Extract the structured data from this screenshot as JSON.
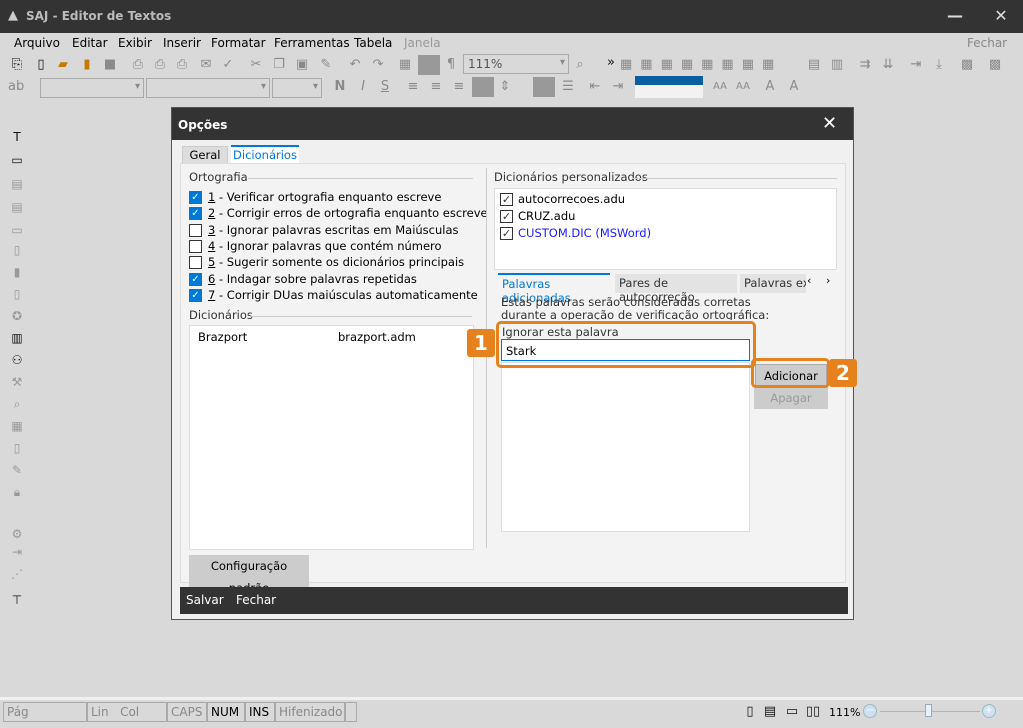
{
  "window": {
    "title": "SAJ - Editor de Textos",
    "close_doc": "Fechar"
  },
  "menu": [
    "Arquivo",
    "Editar",
    "Exibir",
    "Inserir",
    "Formatar",
    "Ferramentas",
    "Tabela",
    "Janela"
  ],
  "toolbar": {
    "zoom": "111%"
  },
  "dialog": {
    "title": "Opções",
    "tabs": [
      {
        "label": "Geral",
        "active": false
      },
      {
        "label": "Dicionários",
        "active": true
      }
    ],
    "ortografia": {
      "label": "Ortografia",
      "options": [
        {
          "num": "1",
          "text": " - Verificar ortografia enquanto escreve",
          "checked": true
        },
        {
          "num": "2",
          "text": " - Corrigir erros de ortografia enquanto escreve",
          "checked": true
        },
        {
          "num": "3",
          "text": " - Ignorar palavras escritas em Maiúsculas",
          "checked": false
        },
        {
          "num": "4",
          "text": " - Ignorar palavras que contém número",
          "checked": false
        },
        {
          "num": "5",
          "text": " - Sugerir somente os dicionários principais",
          "checked": false
        },
        {
          "num": "6",
          "text": " - Indagar sobre palavras repetidas",
          "checked": true
        },
        {
          "num": "7",
          "text": " - Corrigir DUas maiúsculas automaticamente",
          "checked": true
        }
      ]
    },
    "dicionarios": {
      "label": "Dicionários",
      "rows": [
        {
          "name": "Brazport",
          "file": "brazport.adm"
        }
      ]
    },
    "default_button": "Configuração padrão",
    "personalizados": {
      "label": "Dicionários personalizados",
      "items": [
        {
          "name": "autocorrecoes.adu",
          "checked": true
        },
        {
          "name": "CRUZ.adu",
          "checked": true
        },
        {
          "name": "CUSTOM.DIC (MSWord)",
          "checked": true,
          "color": "#1a1aff"
        }
      ]
    },
    "subtabs": [
      "Palavras adicionadas",
      "Pares de autocorreção",
      "Palavras exc"
    ],
    "description": "Estas palavras serão consideradas corretas durante a operação de verificação ortográfica:",
    "ignore_label": "Ignorar esta palavra",
    "ignore_value": "Stark",
    "add_button": "Adicionar",
    "delete_button": "Apagar",
    "footer": {
      "save": "Salvar",
      "close": "Fechar"
    }
  },
  "annotations": {
    "one": "1",
    "two": "2",
    "color": "#e6821e"
  },
  "statusbar": {
    "page": "Pág",
    "line": "Lin",
    "col": "Col",
    "caps": "CAPS",
    "num": "NUM",
    "ins": "INS",
    "hyph": "Hifenizado",
    "zoom": "111%"
  }
}
